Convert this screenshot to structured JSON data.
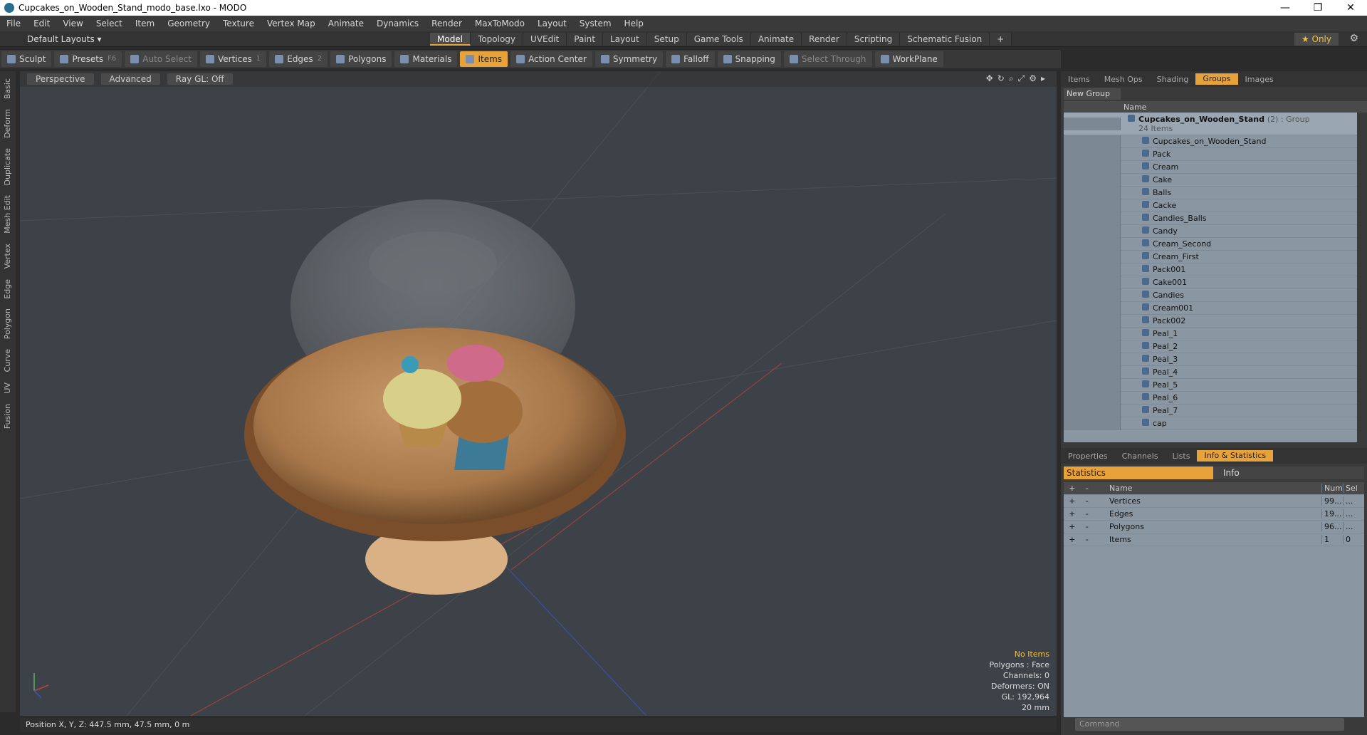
{
  "window": {
    "title": "Cupcakes_on_Wooden_Stand_modo_base.lxo - MODO",
    "minimize": "—",
    "maximize": "❐",
    "close": "✕"
  },
  "menu": [
    "File",
    "Edit",
    "View",
    "Select",
    "Item",
    "Geometry",
    "Texture",
    "Vertex Map",
    "Animate",
    "Dynamics",
    "Render",
    "MaxToModo",
    "Layout",
    "System",
    "Help"
  ],
  "layout": {
    "selector": "Default Layouts ▾",
    "tabs": [
      "Model",
      "Topology",
      "UVEdit",
      "Paint",
      "Layout",
      "Setup",
      "Game Tools",
      "Animate",
      "Render",
      "Scripting",
      "Schematic Fusion"
    ],
    "active_tab": "Model",
    "add": "+",
    "only": "★  Only",
    "gear": "⚙"
  },
  "toolbar": {
    "sculpt": "Sculpt",
    "presets": "Presets",
    "presets_key": "F6",
    "auto_select": "Auto Select",
    "vertices": "Vertices",
    "vertices_key": "1",
    "edges": "Edges",
    "edges_key": "2",
    "polygons": "Polygons",
    "materials": "Materials",
    "items": "Items",
    "action_center": "Action Center",
    "symmetry": "Symmetry",
    "falloff": "Falloff",
    "snapping": "Snapping",
    "select_through": "Select Through",
    "workplane": "WorkPlane"
  },
  "left_tabs": [
    "Basic",
    "Deform",
    "Duplicate",
    "Mesh Edit",
    "Vertex",
    "Edge",
    "Polygon",
    "Curve",
    "UV",
    "Fusion"
  ],
  "viewport": {
    "view": "Perspective",
    "advanced": "Advanced",
    "raygl": "Ray GL: Off",
    "info": {
      "selection": "No Items",
      "polygons": "Polygons : Face",
      "channels": "Channels: 0",
      "deformers": "Deformers: ON",
      "gl": "GL: 192,964",
      "scale": "20 mm"
    }
  },
  "status": {
    "position": "Position X, Y, Z:  447.5 mm, 47.5 mm, 0 m"
  },
  "right_panel": {
    "tabs": [
      "Items",
      "Mesh Ops",
      "Shading",
      "Groups",
      "Images"
    ],
    "active_tab": "Groups",
    "new_group": "New Group",
    "name_header": "Name",
    "group_name": "Cupcakes_on_Wooden_Stand",
    "group_suffix": "(2) : Group",
    "group_count": "24 Items",
    "items": [
      "Cupcakes_on_Wooden_Stand",
      "Pack",
      "Cream",
      "Cake",
      "Balls",
      "Cacke",
      "Candies_Balls",
      "Candy",
      "Cream_Second",
      "Cream_First",
      "Pack001",
      "Cake001",
      "Candies",
      "Cream001",
      "Pack002",
      "Peal_1",
      "Peal_2",
      "Peal_3",
      "Peal_4",
      "Peal_5",
      "Peal_6",
      "Peal_7",
      "cap"
    ],
    "stat_tabs": [
      "Properties",
      "Channels",
      "Lists",
      "Info & Statistics"
    ],
    "stat_active": "Info & Statistics",
    "stat_sub": {
      "statistics": "Statistics",
      "info": "Info"
    },
    "stat_header": {
      "name": "Name",
      "num": "Num",
      "sel": "Sel"
    },
    "stats": [
      {
        "name": "Vertices",
        "num": "99...",
        "sel": "..."
      },
      {
        "name": "Edges",
        "num": "19...",
        "sel": "..."
      },
      {
        "name": "Polygons",
        "num": "96...",
        "sel": "..."
      },
      {
        "name": "Items",
        "num": "1",
        "sel": "0"
      }
    ],
    "command_placeholder": "Command"
  }
}
